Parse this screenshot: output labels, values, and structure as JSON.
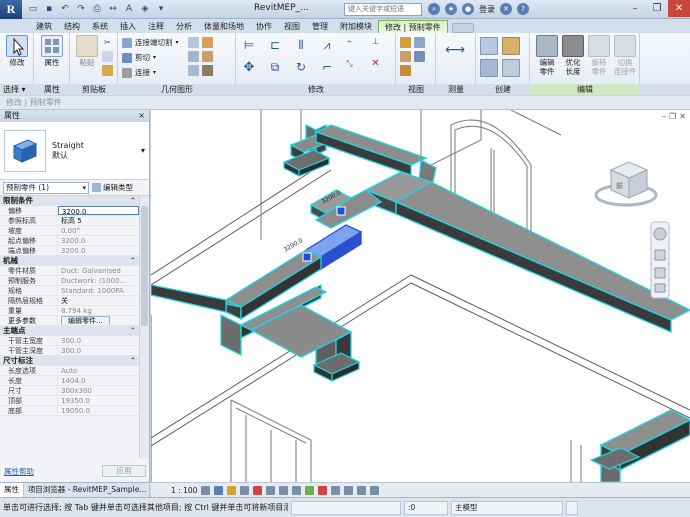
{
  "app": {
    "title": "RevitMEP_...",
    "search_placeholder": "键入关键字或短语",
    "login": "登录",
    "help": "?"
  },
  "tabs": [
    "建筑",
    "结构",
    "系统",
    "插入",
    "注释",
    "分析",
    "体量和场地",
    "协作",
    "视图",
    "管理",
    "附加模块",
    "修改 | 预制零件"
  ],
  "ribbon": {
    "modify_label": "修改",
    "properties_label": "属性",
    "paste_label": "粘贴",
    "connect_cut": "连接端切割",
    "cut": "剪切",
    "join": "连接",
    "panels": {
      "select": "选择 ▾",
      "properties": "属性",
      "clipboard": "剪贴板",
      "geometry": "几何图形",
      "modify": "修改",
      "view": "视图",
      "measure": "测量",
      "create": "创建",
      "edit": "编辑"
    },
    "edit_buttons": [
      "编辑\n零件",
      "优化\n长度",
      "旋转\n零件",
      "切换\n连接件"
    ]
  },
  "context_bar": "修改 | 预制零件",
  "properties": {
    "header": "属性",
    "close": "×",
    "type_name": "Straight",
    "type_sub": "默认",
    "instance_select": "预制零件 (1)",
    "edit_type": "编辑类型",
    "groups": [
      {
        "name": "限制条件",
        "rows": [
          {
            "k": "偏移",
            "v": "3200.0",
            "style": "ed"
          },
          {
            "k": "参照标高",
            "v": "标高 5",
            "style": "dark"
          },
          {
            "k": "坡度",
            "v": "0.00°",
            "style": ""
          },
          {
            "k": "起点偏移",
            "v": "3200.0",
            "style": ""
          },
          {
            "k": "端点偏移",
            "v": "3200.0",
            "style": ""
          }
        ]
      },
      {
        "name": "机械",
        "rows": [
          {
            "k": "零件材质",
            "v": "Duct: Galvanised",
            "style": ""
          },
          {
            "k": "预制服务",
            "v": "Ductwork: (1000...",
            "style": ""
          },
          {
            "k": "规格",
            "v": "Standard: 1000PA",
            "style": ""
          },
          {
            "k": "隔热层规格",
            "v": "关",
            "style": "dark"
          },
          {
            "k": "重量",
            "v": "8.794 kg",
            "style": ""
          },
          {
            "k": "更多参数",
            "v": "编辑零件...",
            "style": "btn"
          }
        ]
      },
      {
        "name": "主端点",
        "rows": [
          {
            "k": "干管主宽度",
            "v": "300.0",
            "style": ""
          },
          {
            "k": "干管主深度",
            "v": "300.0",
            "style": ""
          }
        ]
      },
      {
        "name": "尺寸标注",
        "rows": [
          {
            "k": "长度选项",
            "v": "Auto",
            "style": ""
          },
          {
            "k": "长度",
            "v": "1404.0",
            "style": ""
          },
          {
            "k": "尺寸",
            "v": "300x300",
            "style": ""
          },
          {
            "k": "顶部",
            "v": "19350.0",
            "style": ""
          },
          {
            "k": "底部",
            "v": "19050.0",
            "style": ""
          }
        ]
      }
    ],
    "collapse_glyph": "⌃",
    "help_link": "属性帮助",
    "apply": "应用"
  },
  "palette_tabs": [
    "属性",
    "项目浏览器 - RevitMEP_Sample..."
  ],
  "viewport": {
    "dim_label_1": "3200.0",
    "dim_label_2": "3200.0",
    "viewcube_face": "前"
  },
  "view_bar": {
    "scale": "1 : 100"
  },
  "status": {
    "message": "单击可进行选择; 按 Tab 键并单击可选择其他项目; 按 Ctrl 键并单击可将新项目添",
    "zero": ":0",
    "model": "主模型"
  },
  "colors": {
    "duct_gray": "#6e6e6e",
    "duct_dark": "#3e3e3e",
    "highlight_cyan": "#1fd6e3",
    "selected_blue": "#4a6fe0",
    "context_tab_green": "#d8f0c6"
  }
}
